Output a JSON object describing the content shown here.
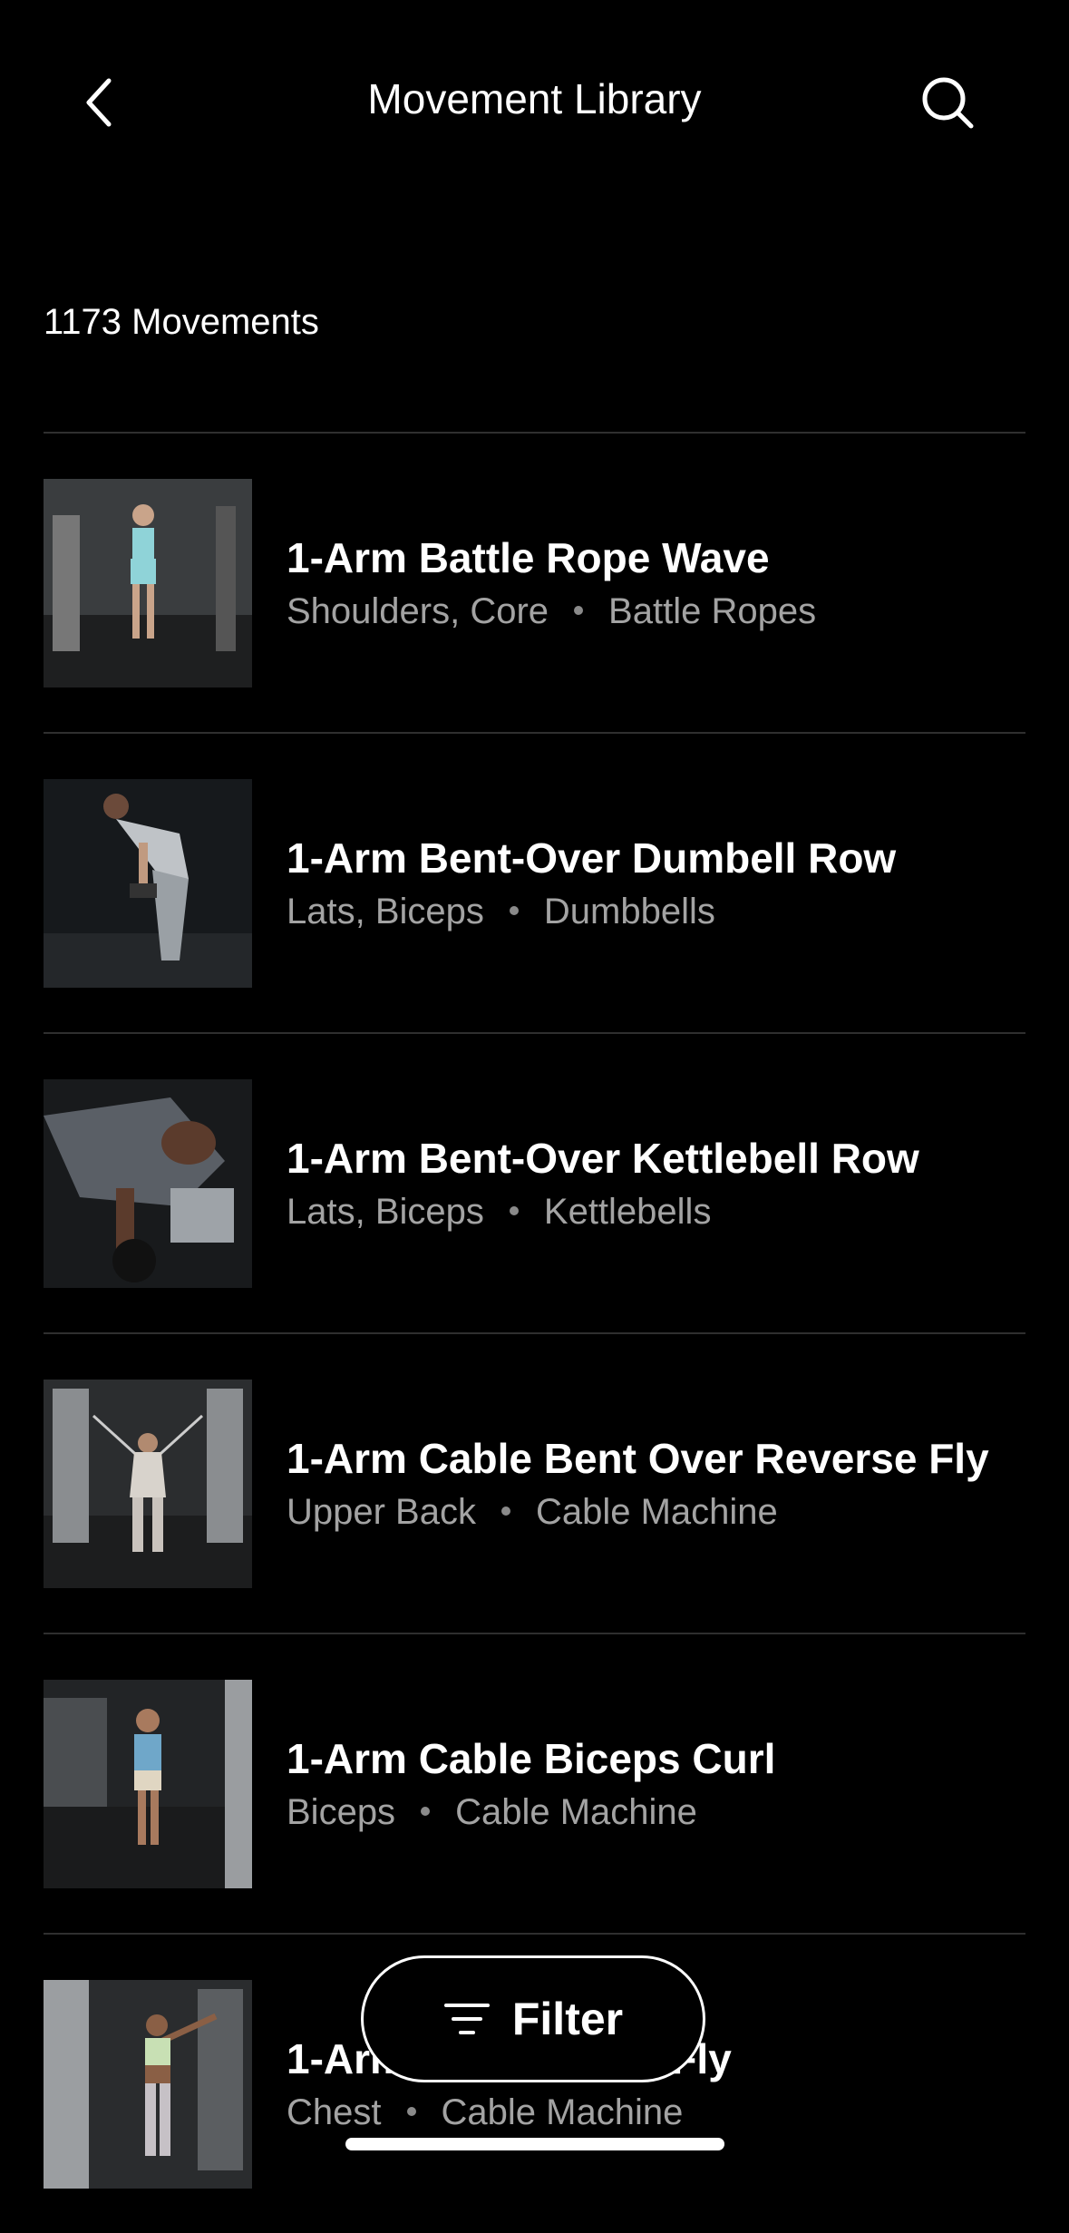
{
  "header": {
    "title": "Movement Library",
    "back_icon": "chevron-left-icon",
    "search_icon": "search-icon"
  },
  "summary": {
    "count_text": "1173 Movements"
  },
  "movements": [
    {
      "name": "1-Arm Battle Rope Wave",
      "muscles": "Shoulders, Core",
      "equipment": "Battle Ropes"
    },
    {
      "name": "1-Arm Bent-Over Dumbell Row",
      "muscles": "Lats, Biceps",
      "equipment": "Dumbbells"
    },
    {
      "name": "1-Arm Bent-Over Kettlebell Row",
      "muscles": "Lats, Biceps",
      "equipment": "Kettlebells"
    },
    {
      "name": "1-Arm Cable Bent Over Reverse Fly",
      "muscles": "Upper Back",
      "equipment": "Cable Machine"
    },
    {
      "name": "1-Arm Cable Biceps Curl",
      "muscles": "Biceps",
      "equipment": "Cable Machine"
    },
    {
      "name": "1-Arm Cable Chest Fly",
      "muscles": "Chest",
      "equipment": "Cable Machine"
    }
  ],
  "filter": {
    "label": "Filter",
    "icon": "filter-lines-icon"
  },
  "colors": {
    "background": "#000000",
    "text_primary": "#ffffff",
    "text_secondary": "#a3a3a3",
    "divider": "#2f2f2f"
  }
}
